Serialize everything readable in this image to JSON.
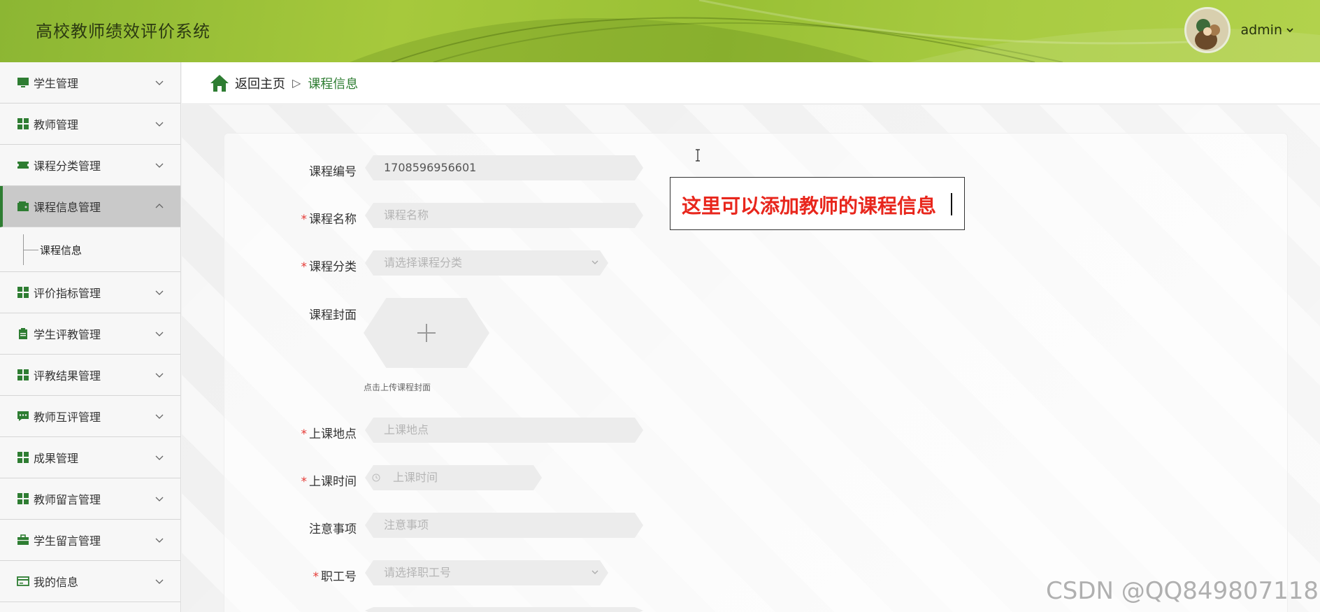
{
  "header": {
    "title": "高校教师绩效评价系统",
    "user": "admin"
  },
  "sidebar": {
    "items": [
      {
        "label": "学生管理",
        "icon": "monitor-icon"
      },
      {
        "label": "教师管理",
        "icon": "grid-icon"
      },
      {
        "label": "课程分类管理",
        "icon": "ticket-icon"
      },
      {
        "label": "课程信息管理",
        "icon": "wallet-icon",
        "active": true
      },
      {
        "label": "评价指标管理",
        "icon": "grid-icon"
      },
      {
        "label": "学生评教管理",
        "icon": "clipboard-icon"
      },
      {
        "label": "评教结果管理",
        "icon": "grid-icon"
      },
      {
        "label": "教师互评管理",
        "icon": "chat-icon"
      },
      {
        "label": "成果管理",
        "icon": "grid-icon"
      },
      {
        "label": "教师留言管理",
        "icon": "grid-icon"
      },
      {
        "label": "学生留言管理",
        "icon": "briefcase-icon"
      },
      {
        "label": "我的信息",
        "icon": "card-icon"
      }
    ],
    "submenu": {
      "label": "课程信息"
    }
  },
  "breadcrumb": {
    "home": "返回主页",
    "separator": "▷",
    "current": "课程信息"
  },
  "form": {
    "course_no": {
      "label": "课程编号",
      "value": "1708596956601"
    },
    "course_name": {
      "label": "课程名称",
      "placeholder": "课程名称"
    },
    "course_category": {
      "label": "课程分类",
      "placeholder": "请选择课程分类"
    },
    "course_cover": {
      "label": "课程封面",
      "hint": "点击上传课程封面"
    },
    "location": {
      "label": "上课地点",
      "placeholder": "上课地点"
    },
    "time": {
      "label": "上课时间",
      "placeholder": "上课时间"
    },
    "notes": {
      "label": "注意事项",
      "placeholder": "注意事项"
    },
    "staff_no": {
      "label": "职工号",
      "placeholder": "请选择职工号"
    },
    "required_mark": "*"
  },
  "annotation": {
    "text": "这里可以添加教师的课程信息"
  },
  "watermark": "CSDN @QQ849807118",
  "colors": {
    "header_green": "#a6c93c",
    "accent_green": "#2e7d32",
    "annotation_red": "#e8261c"
  }
}
